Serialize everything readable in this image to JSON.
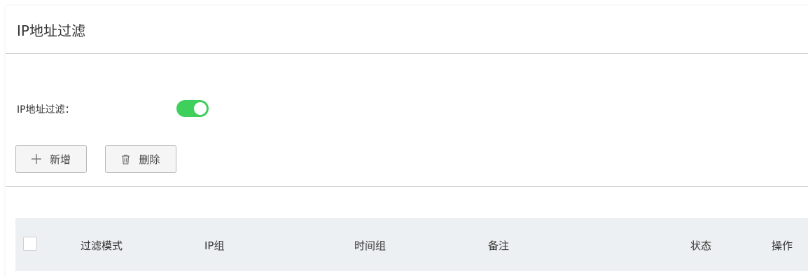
{
  "page": {
    "title": "IP地址过滤"
  },
  "filter": {
    "label": "IP地址过滤：",
    "enabled": true,
    "toggle_color": "#3fcf5b"
  },
  "toolbar": {
    "add": {
      "label": "新增",
      "icon": "plus-icon"
    },
    "delete": {
      "label": "删除",
      "icon": "trash-icon"
    }
  },
  "table": {
    "columns": [
      "过滤模式",
      "IP组",
      "时间组",
      "备注",
      "状态",
      "操作"
    ],
    "select_all_checked": false
  }
}
